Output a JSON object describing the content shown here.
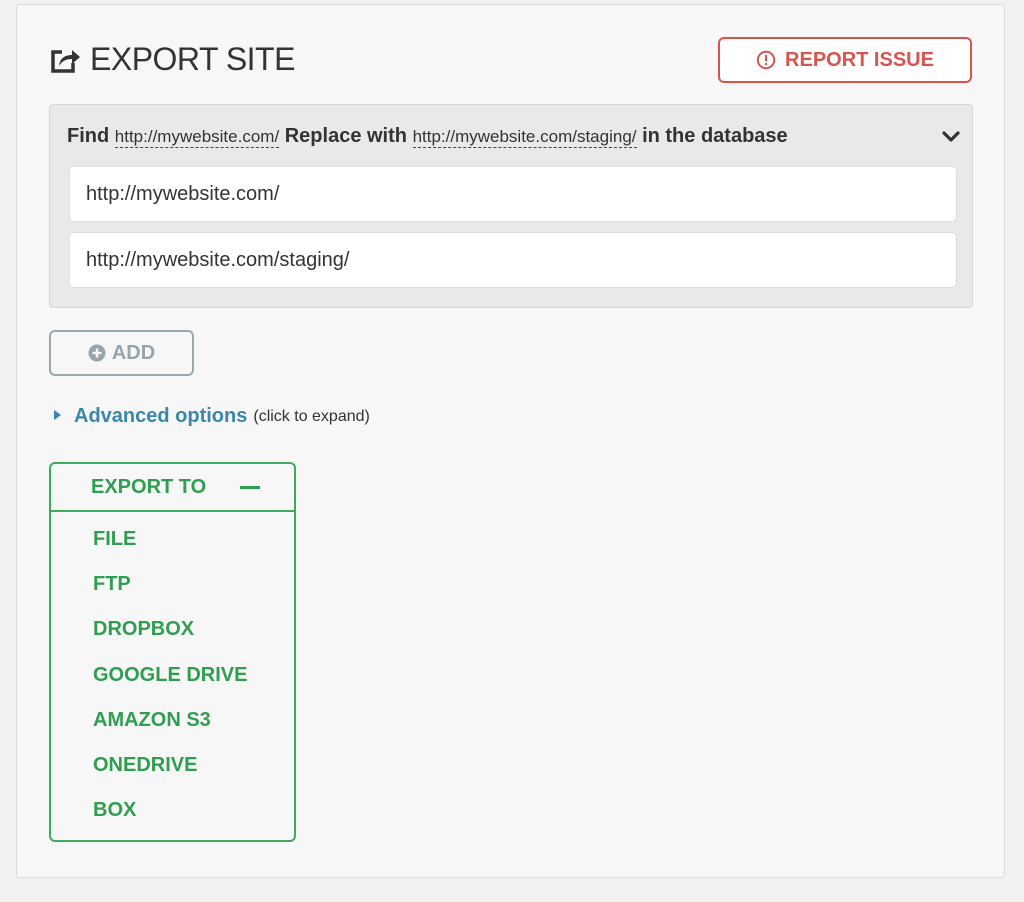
{
  "header": {
    "title": "EXPORT SITE",
    "icon": "share-export-icon"
  },
  "report_button": {
    "label": "REPORT ISSUE",
    "icon": "exclamation-circle-icon",
    "color": "#d9534f"
  },
  "find_replace": {
    "find_label": "Find",
    "find_url": "http://mywebsite.com/",
    "replace_label": "Replace with",
    "replace_url": "http://mywebsite.com/staging/",
    "suffix": "in the database",
    "find_input_value": "http://mywebsite.com/",
    "replace_input_value": "http://mywebsite.com/staging/",
    "collapse_icon": "chevron-down-icon"
  },
  "add_button": {
    "label": "ADD",
    "icon": "plus-circle-icon"
  },
  "advanced": {
    "link": "Advanced options",
    "hint": "(click to expand)",
    "color": "#3a87ad"
  },
  "export_to": {
    "title": "EXPORT TO",
    "color": "#3daa5c",
    "items": [
      {
        "label": "FILE"
      },
      {
        "label": "FTP"
      },
      {
        "label": "DROPBOX"
      },
      {
        "label": "GOOGLE DRIVE"
      },
      {
        "label": "AMAZON S3"
      },
      {
        "label": "ONEDRIVE"
      },
      {
        "label": "BOX"
      }
    ]
  }
}
